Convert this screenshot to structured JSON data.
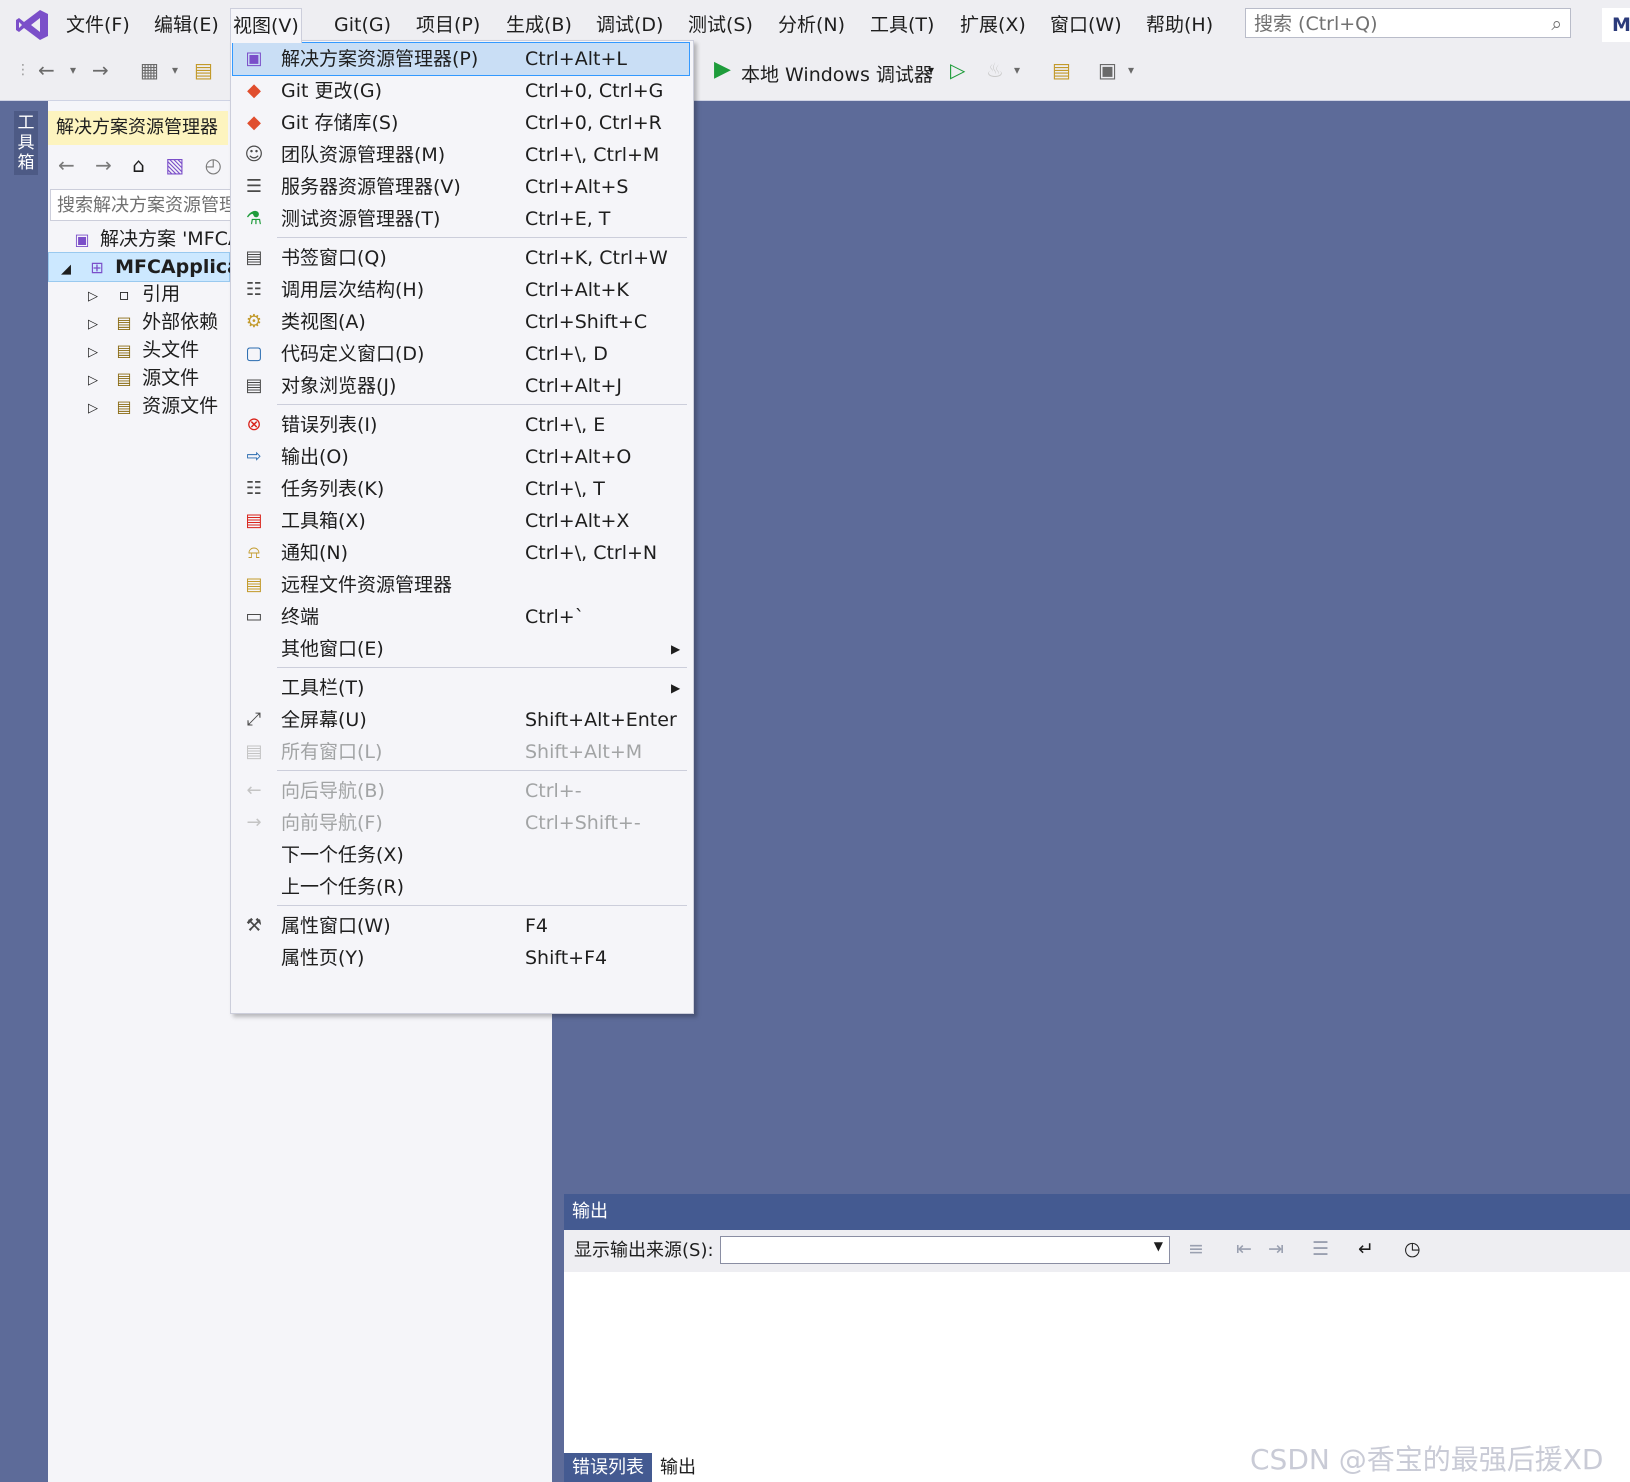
{
  "menubar": {
    "items": [
      "文件(F)",
      "编辑(E)",
      "视图(V)",
      "Git(G)",
      "项目(P)",
      "生成(B)",
      "调试(D)",
      "测试(S)",
      "分析(N)",
      "工具(T)",
      "扩展(X)",
      "窗口(W)",
      "帮助(H)"
    ],
    "search_placeholder": "搜索 (Ctrl+Q)",
    "corner_label": "M"
  },
  "toolbar": {
    "run_label": "本地 Windows 调试器"
  },
  "toolstrip": {
    "tab_label": "工具箱"
  },
  "solution_explorer": {
    "title": "解决方案资源管理器",
    "search_placeholder": "搜索解决方案资源管理",
    "tree": [
      {
        "label": "解决方案 'MFCA",
        "icon": "solution-icon"
      },
      {
        "label": "MFCApplica",
        "icon": "project-icon"
      },
      {
        "label": "引用",
        "icon": "references-icon"
      },
      {
        "label": "外部依赖",
        "icon": "external-deps-icon"
      },
      {
        "label": "头文件",
        "icon": "filter-folder-icon"
      },
      {
        "label": "源文件",
        "icon": "filter-folder-icon"
      },
      {
        "label": "资源文件",
        "icon": "filter-folder-icon"
      }
    ]
  },
  "view_menu": {
    "items": [
      {
        "label": "解决方案资源管理器(P)",
        "shortcut": "Ctrl+Alt+L",
        "icon": "solution-explorer-icon"
      },
      {
        "label": "Git 更改(G)",
        "shortcut": "Ctrl+0, Ctrl+G",
        "icon": "git-changes-icon"
      },
      {
        "label": "Git 存储库(S)",
        "shortcut": "Ctrl+0, Ctrl+R",
        "icon": "git-repo-icon"
      },
      {
        "label": "团队资源管理器(M)",
        "shortcut": "Ctrl+\\, Ctrl+M",
        "icon": "team-explorer-icon"
      },
      {
        "label": "服务器资源管理器(V)",
        "shortcut": "Ctrl+Alt+S",
        "icon": "server-explorer-icon"
      },
      {
        "label": "测试资源管理器(T)",
        "shortcut": "Ctrl+E, T",
        "icon": "test-explorer-icon"
      },
      {
        "label": "书签窗口(Q)",
        "shortcut": "Ctrl+K, Ctrl+W",
        "icon": "bookmark-icon"
      },
      {
        "label": "调用层次结构(H)",
        "shortcut": "Ctrl+Alt+K",
        "icon": "call-hierarchy-icon"
      },
      {
        "label": "类视图(A)",
        "shortcut": "Ctrl+Shift+C",
        "icon": "class-view-icon"
      },
      {
        "label": "代码定义窗口(D)",
        "shortcut": "Ctrl+\\, D",
        "icon": "code-definition-icon"
      },
      {
        "label": "对象浏览器(J)",
        "shortcut": "Ctrl+Alt+J",
        "icon": "object-browser-icon"
      },
      {
        "label": "错误列表(I)",
        "shortcut": "Ctrl+\\, E",
        "icon": "error-list-icon"
      },
      {
        "label": "输出(O)",
        "shortcut": "Ctrl+Alt+O",
        "icon": "output-icon"
      },
      {
        "label": "任务列表(K)",
        "shortcut": "Ctrl+\\, T",
        "icon": "task-list-icon"
      },
      {
        "label": "工具箱(X)",
        "shortcut": "Ctrl+Alt+X",
        "icon": "toolbox-icon"
      },
      {
        "label": "通知(N)",
        "shortcut": "Ctrl+\\, Ctrl+N",
        "icon": "bell-icon"
      },
      {
        "label": "远程文件资源管理器",
        "shortcut": "",
        "icon": "remote-files-icon"
      },
      {
        "label": "终端",
        "shortcut": "Ctrl+`",
        "icon": "terminal-icon"
      },
      {
        "label": "其他窗口(E)",
        "shortcut": "",
        "icon": ""
      },
      {
        "label": "工具栏(T)",
        "shortcut": "",
        "icon": ""
      },
      {
        "label": "全屏幕(U)",
        "shortcut": "Shift+Alt+Enter",
        "icon": "fullscreen-icon"
      },
      {
        "label": "所有窗口(L)",
        "shortcut": "Shift+Alt+M",
        "icon": "all-windows-icon"
      },
      {
        "label": "向后导航(B)",
        "shortcut": "Ctrl+-",
        "icon": "navigate-back-icon"
      },
      {
        "label": "向前导航(F)",
        "shortcut": "Ctrl+Shift+-",
        "icon": "navigate-forward-icon"
      },
      {
        "label": "下一个任务(X)",
        "shortcut": "",
        "icon": ""
      },
      {
        "label": "上一个任务(R)",
        "shortcut": "",
        "icon": ""
      },
      {
        "label": "属性窗口(W)",
        "shortcut": "F4",
        "icon": "wrench-icon"
      },
      {
        "label": "属性页(Y)",
        "shortcut": "Shift+F4",
        "icon": ""
      }
    ]
  },
  "output_panel": {
    "title": "输出",
    "source_label": "显示输出来源(S):",
    "source_value": "",
    "tabs": [
      "错误列表",
      "输出"
    ]
  },
  "watermark": "CSDN @香宝的最强后援XD"
}
